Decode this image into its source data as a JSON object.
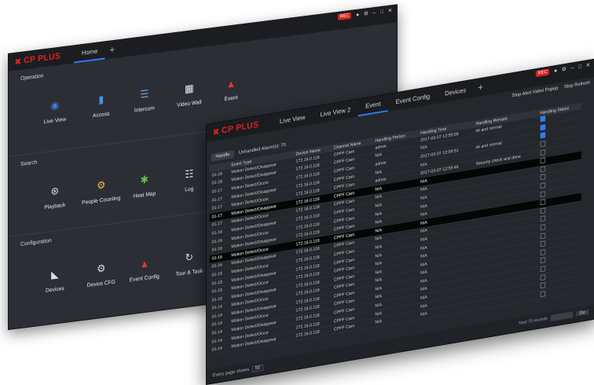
{
  "back_window": {
    "brand": "CP PLUS",
    "tabs": [
      {
        "label": "Home"
      }
    ],
    "sections": [
      {
        "title": "Operation",
        "items": [
          {
            "label": "Live View",
            "icon": "camera-lens-icon",
            "color": "#3d7be0"
          },
          {
            "label": "Access",
            "icon": "tablet-icon",
            "color": "#4a8ff0"
          },
          {
            "label": "Intercom",
            "icon": "intercom-icon",
            "color": "#6aa0e0"
          },
          {
            "label": "Video Wall",
            "icon": "video-wall-icon",
            "color": "#e8e8e8"
          },
          {
            "label": "Event",
            "icon": "alarm-light-icon",
            "color": "#e03a2a"
          }
        ]
      },
      {
        "title": "Search",
        "items": [
          {
            "label": "Playback",
            "icon": "playback-reel-icon",
            "color": "#dddddd"
          },
          {
            "label": "People Counting",
            "icon": "people-counting-icon",
            "color": "#f3b640"
          },
          {
            "label": "Heat Map",
            "icon": "heat-map-icon",
            "color": "#6cbf3a"
          },
          {
            "label": "Log",
            "icon": "log-icon",
            "color": "#e8e8e8"
          }
        ]
      },
      {
        "title": "Configuration",
        "items": [
          {
            "label": "Devices",
            "icon": "cctv-camera-icon",
            "color": "#dddddd"
          },
          {
            "label": "Device CFG",
            "icon": "device-config-icon",
            "color": "#dddddd"
          },
          {
            "label": "Event Config",
            "icon": "event-config-icon",
            "color": "#e03a2a"
          },
          {
            "label": "Tour & Task",
            "icon": "tour-task-icon",
            "color": "#dddddd"
          }
        ]
      }
    ]
  },
  "front_window": {
    "brand": "CP PLUS",
    "tabs": [
      {
        "label": "Live View"
      },
      {
        "label": "Live View 2"
      },
      {
        "label": "Event"
      },
      {
        "label": "Event Config"
      },
      {
        "label": "Devices"
      }
    ],
    "toolbar": {
      "video_popup": "Stop Alert Video Popup",
      "stop_refresh": "Stop Refresh"
    },
    "subbar": {
      "handle_button": "Handle",
      "unhandled": "Unhandled Alarm(s): 70"
    },
    "columns": [
      "",
      "Event Type",
      "Device Name",
      "Channel Name",
      "Handling Person",
      "Handling Time",
      "Handling Remark",
      "Handling Status"
    ],
    "rows": [
      {
        "id": "01-18",
        "type": "Motion Detect/Disappear",
        "device": "172.16.0.118",
        "channel": "CPPF Cam",
        "person": "admin",
        "time": "2017-03-07 12:59:58",
        "remark": "ok and normal",
        "status": true,
        "hl": false
      },
      {
        "id": "01-18",
        "type": "Motion Detect/Disappear",
        "device": "172.16.0.118",
        "channel": "CPPF Cam",
        "person": "N/A",
        "time": "N/A",
        "remark": "",
        "status": true,
        "hl": false
      },
      {
        "id": "01-17",
        "type": "Motion Detect/Occur",
        "device": "172.16.0.118",
        "channel": "CPPF Cam",
        "person": "admin",
        "time": "2017-03-07 12:59:51",
        "remark": "ok and normal",
        "status": true,
        "hl": false
      },
      {
        "id": "01-17",
        "type": "Motion Detect/Disappear",
        "device": "172.16.0.118",
        "channel": "CPPF Cam",
        "person": "N/A",
        "time": "N/A",
        "remark": "",
        "status": false,
        "hl": false
      },
      {
        "id": "01-17",
        "type": "Motion Detect/Occur",
        "device": "172.16.0.118",
        "channel": "CPPF Cam",
        "person": "admin",
        "time": "2017-03-07 12:59:48",
        "remark": "Security check and done",
        "status": false,
        "hl": false
      },
      {
        "id": "01-17",
        "type": "Motion Detect/Disappear",
        "device": "172.16.0.118",
        "channel": "CPPF Cam",
        "person": "N/A",
        "time": "N/A",
        "remark": "",
        "status": false,
        "hl": true
      },
      {
        "id": "01-17",
        "type": "Motion Detect/Occur",
        "device": "172.16.0.118",
        "channel": "CPPF Cam",
        "person": "N/A",
        "time": "N/A",
        "remark": "",
        "status": false,
        "hl": false
      },
      {
        "id": "01-16",
        "type": "Motion Detect/Disappear",
        "device": "172.16.0.118",
        "channel": "CPPF Cam",
        "person": "N/A",
        "time": "N/A",
        "remark": "",
        "status": false,
        "hl": false
      },
      {
        "id": "01-16",
        "type": "Motion Detect/Occur",
        "device": "172.16.0.118",
        "channel": "CPPF Cam",
        "person": "N/A",
        "time": "N/A",
        "remark": "",
        "status": false,
        "hl": false
      },
      {
        "id": "01-16",
        "type": "Motion Detect/Disappear",
        "device": "172.16.0.118",
        "channel": "CPPF Cam",
        "person": "N/A",
        "time": "N/A",
        "remark": "",
        "status": false,
        "hl": false
      },
      {
        "id": "01-16",
        "type": "Motion Detect/Occur",
        "device": "172.16.0.118",
        "channel": "CPPF Cam",
        "person": "N/A",
        "time": "N/A",
        "remark": "",
        "status": false,
        "hl": true
      },
      {
        "id": "01-16",
        "type": "Motion Detect/Disappear",
        "device": "172.16.0.118",
        "channel": "CPPF Cam",
        "person": "N/A",
        "time": "N/A",
        "remark": "",
        "status": false,
        "hl": false
      },
      {
        "id": "01-15",
        "type": "Motion Detect/Occur",
        "device": "172.16.0.118",
        "channel": "CPPF Cam",
        "person": "N/A",
        "time": "N/A",
        "remark": "",
        "status": false,
        "hl": false
      },
      {
        "id": "01-15",
        "type": "Motion Detect/Disappear",
        "device": "172.16.0.118",
        "channel": "CPPF Cam",
        "person": "N/A",
        "time": "N/A",
        "remark": "",
        "status": false,
        "hl": false
      },
      {
        "id": "01-15",
        "type": "Motion Detect/Occur",
        "device": "172.16.0.118",
        "channel": "CPPF Cam",
        "person": "N/A",
        "time": "N/A",
        "remark": "",
        "status": false,
        "hl": false
      },
      {
        "id": "01-15",
        "type": "Motion Detect/Disappear",
        "device": "172.16.0.118",
        "channel": "CPPF Cam",
        "person": "N/A",
        "time": "N/A",
        "remark": "",
        "status": false,
        "hl": false
      },
      {
        "id": "01-14",
        "type": "Motion Detect/Occur",
        "device": "172.16.0.118",
        "channel": "CPPF Cam",
        "person": "N/A",
        "time": "N/A",
        "remark": "",
        "status": false,
        "hl": false
      },
      {
        "id": "01-14",
        "type": "Motion Detect/Disappear",
        "device": "172.16.0.118",
        "channel": "CPPF Cam",
        "person": "N/A",
        "time": "N/A",
        "remark": "",
        "status": false,
        "hl": false
      },
      {
        "id": "01-14",
        "type": "Motion Detect/Occur",
        "device": "172.16.0.118",
        "channel": "CPPF Cam",
        "person": "N/A",
        "time": "N/A",
        "remark": "",
        "status": false,
        "hl": false
      },
      {
        "id": "01-14",
        "type": "Motion Detect/Disappear",
        "device": "172.16.0.118",
        "channel": "CPPF Cam",
        "person": "N/A",
        "time": "N/A",
        "remark": "",
        "status": false,
        "hl": false
      },
      {
        "id": "01-14",
        "type": "Motion Detect/Occur",
        "device": "172.16.0.118",
        "channel": "CPPF Cam",
        "person": "N/A",
        "time": "N/A",
        "remark": "",
        "status": false,
        "hl": false
      },
      {
        "id": "01-14",
        "type": "Motion Detect/Disappear",
        "device": "172.16.0.118",
        "channel": "CPPF Cam",
        "person": "N/A",
        "time": "N/A",
        "remark": "",
        "status": false,
        "hl": false
      }
    ],
    "footer": {
      "per_page_label": "Every page shows",
      "per_page": "50",
      "pager_text": "Total 70 records",
      "go": "Go"
    }
  },
  "colors": {
    "accent": "#2f7bf5",
    "brand_red": "#e02020"
  }
}
